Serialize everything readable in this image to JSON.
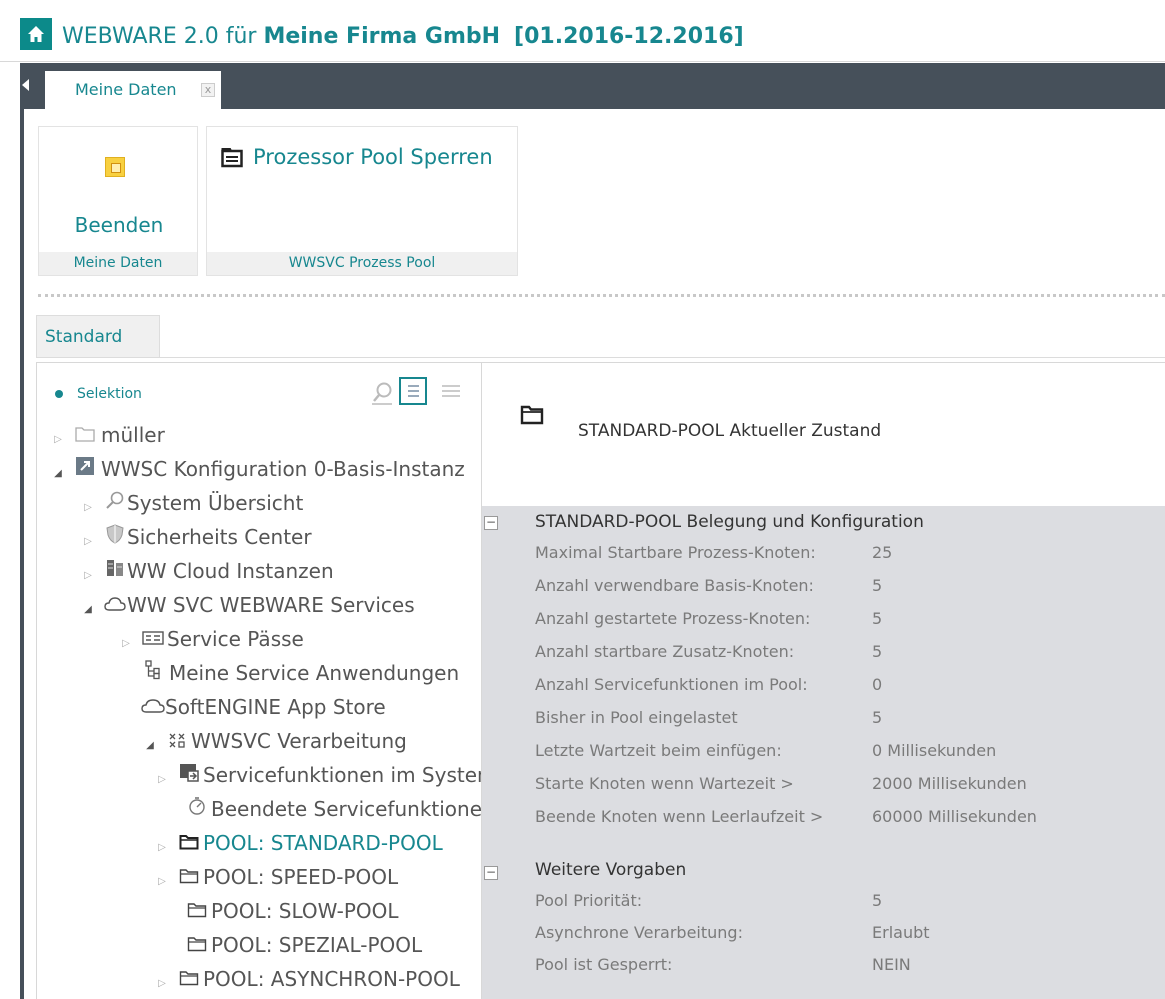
{
  "app": {
    "title_prefix": "WEBWARE 2.0 für ",
    "title_company": "Meine Firma GmbH",
    "title_period": "[01.2016-12.2016]"
  },
  "tabs": [
    {
      "label": "Meine Daten",
      "close": "x"
    }
  ],
  "ribbon": {
    "groups": [
      {
        "label": "Meine Daten",
        "button": "Beenden",
        "icon": "exit-icon"
      },
      {
        "label": "WWSVC Prozess Pool",
        "button": "Prozessor Pool Sperren",
        "icon": "list-box-icon"
      }
    ]
  },
  "view_tabs": [
    "Standard"
  ],
  "tree": {
    "header": "Selektion",
    "tools": [
      "search-icon",
      "list-view-icon",
      "menu-icon"
    ],
    "items": [
      {
        "label": "müller",
        "icon": "folder-icon"
      },
      {
        "label": "WWSC Konfiguration 0-Basis-Instanz",
        "icon": "config-icon"
      },
      {
        "label": "System Übersicht",
        "icon": "magnifier-icon"
      },
      {
        "label": "Sicherheits Center",
        "icon": "shield-icon"
      },
      {
        "label": "WW Cloud Instanzen",
        "icon": "cloud-servers-icon"
      },
      {
        "label": "WW SVC WEBWARE Services",
        "icon": "cloud-icon"
      },
      {
        "label": "Service Pässe",
        "icon": "card-icon"
      },
      {
        "label": "Meine Service Anwendungen",
        "icon": "hierarchy-icon"
      },
      {
        "label": "SoftENGINE App Store",
        "icon": "cloud-icon"
      },
      {
        "label": "WWSVC Verarbeitung",
        "icon": "process-icon"
      },
      {
        "label": "Servicefunktionen im System",
        "icon": "screen-icon"
      },
      {
        "label": "Beendete Servicefunktionen",
        "icon": "stopwatch-icon"
      },
      {
        "label": "POOL: STANDARD-POOL",
        "icon": "folder-icon"
      },
      {
        "label": "POOL: SPEED-POOL",
        "icon": "folder-icon"
      },
      {
        "label": "POOL: SLOW-POOL",
        "icon": "folder-icon"
      },
      {
        "label": "POOL: SPEZIAL-POOL",
        "icon": "folder-icon"
      },
      {
        "label": "POOL: ASYNCHRON-POOL",
        "icon": "folder-icon"
      }
    ]
  },
  "detail": {
    "title": "STANDARD-POOL Aktueller Zustand",
    "sections": [
      {
        "title": "STANDARD-POOL Belegung und Konfiguration",
        "toggle": "−",
        "rows": [
          {
            "label": "Maximal Startbare Prozess-Knoten:",
            "value": "25"
          },
          {
            "label": "Anzahl verwendbare Basis-Knoten:",
            "value": "5"
          },
          {
            "label": "Anzahl gestartete Prozess-Knoten:",
            "value": "5"
          },
          {
            "label": "Anzahl startbare Zusatz-Knoten:",
            "value": "5"
          },
          {
            "label": "Anzahl Servicefunktionen im Pool:",
            "value": "0"
          },
          {
            "label": "Bisher in Pool eingelastet",
            "value": "5"
          },
          {
            "label": "Letzte Wartzeit beim einfügen:",
            "value": "0 Millisekunden"
          },
          {
            "label": "Starte Knoten wenn Wartezeit >",
            "value": "2000 Millisekunden"
          },
          {
            "label": "Beende Knoten wenn Leerlaufzeit >",
            "value": "60000 Millisekunden"
          }
        ]
      },
      {
        "title": "Weitere Vorgaben",
        "toggle": "−",
        "rows": [
          {
            "label": "Pool Priorität:",
            "value": "5"
          },
          {
            "label": "Asynchrone Verarbeitung:",
            "value": "Erlaubt"
          },
          {
            "label": "Pool ist Gesperrt:",
            "value": "NEIN"
          }
        ]
      }
    ]
  },
  "colors": {
    "accent": "#17878f",
    "dark_bar": "#46505a",
    "panel_bg": "#dcdde1"
  }
}
